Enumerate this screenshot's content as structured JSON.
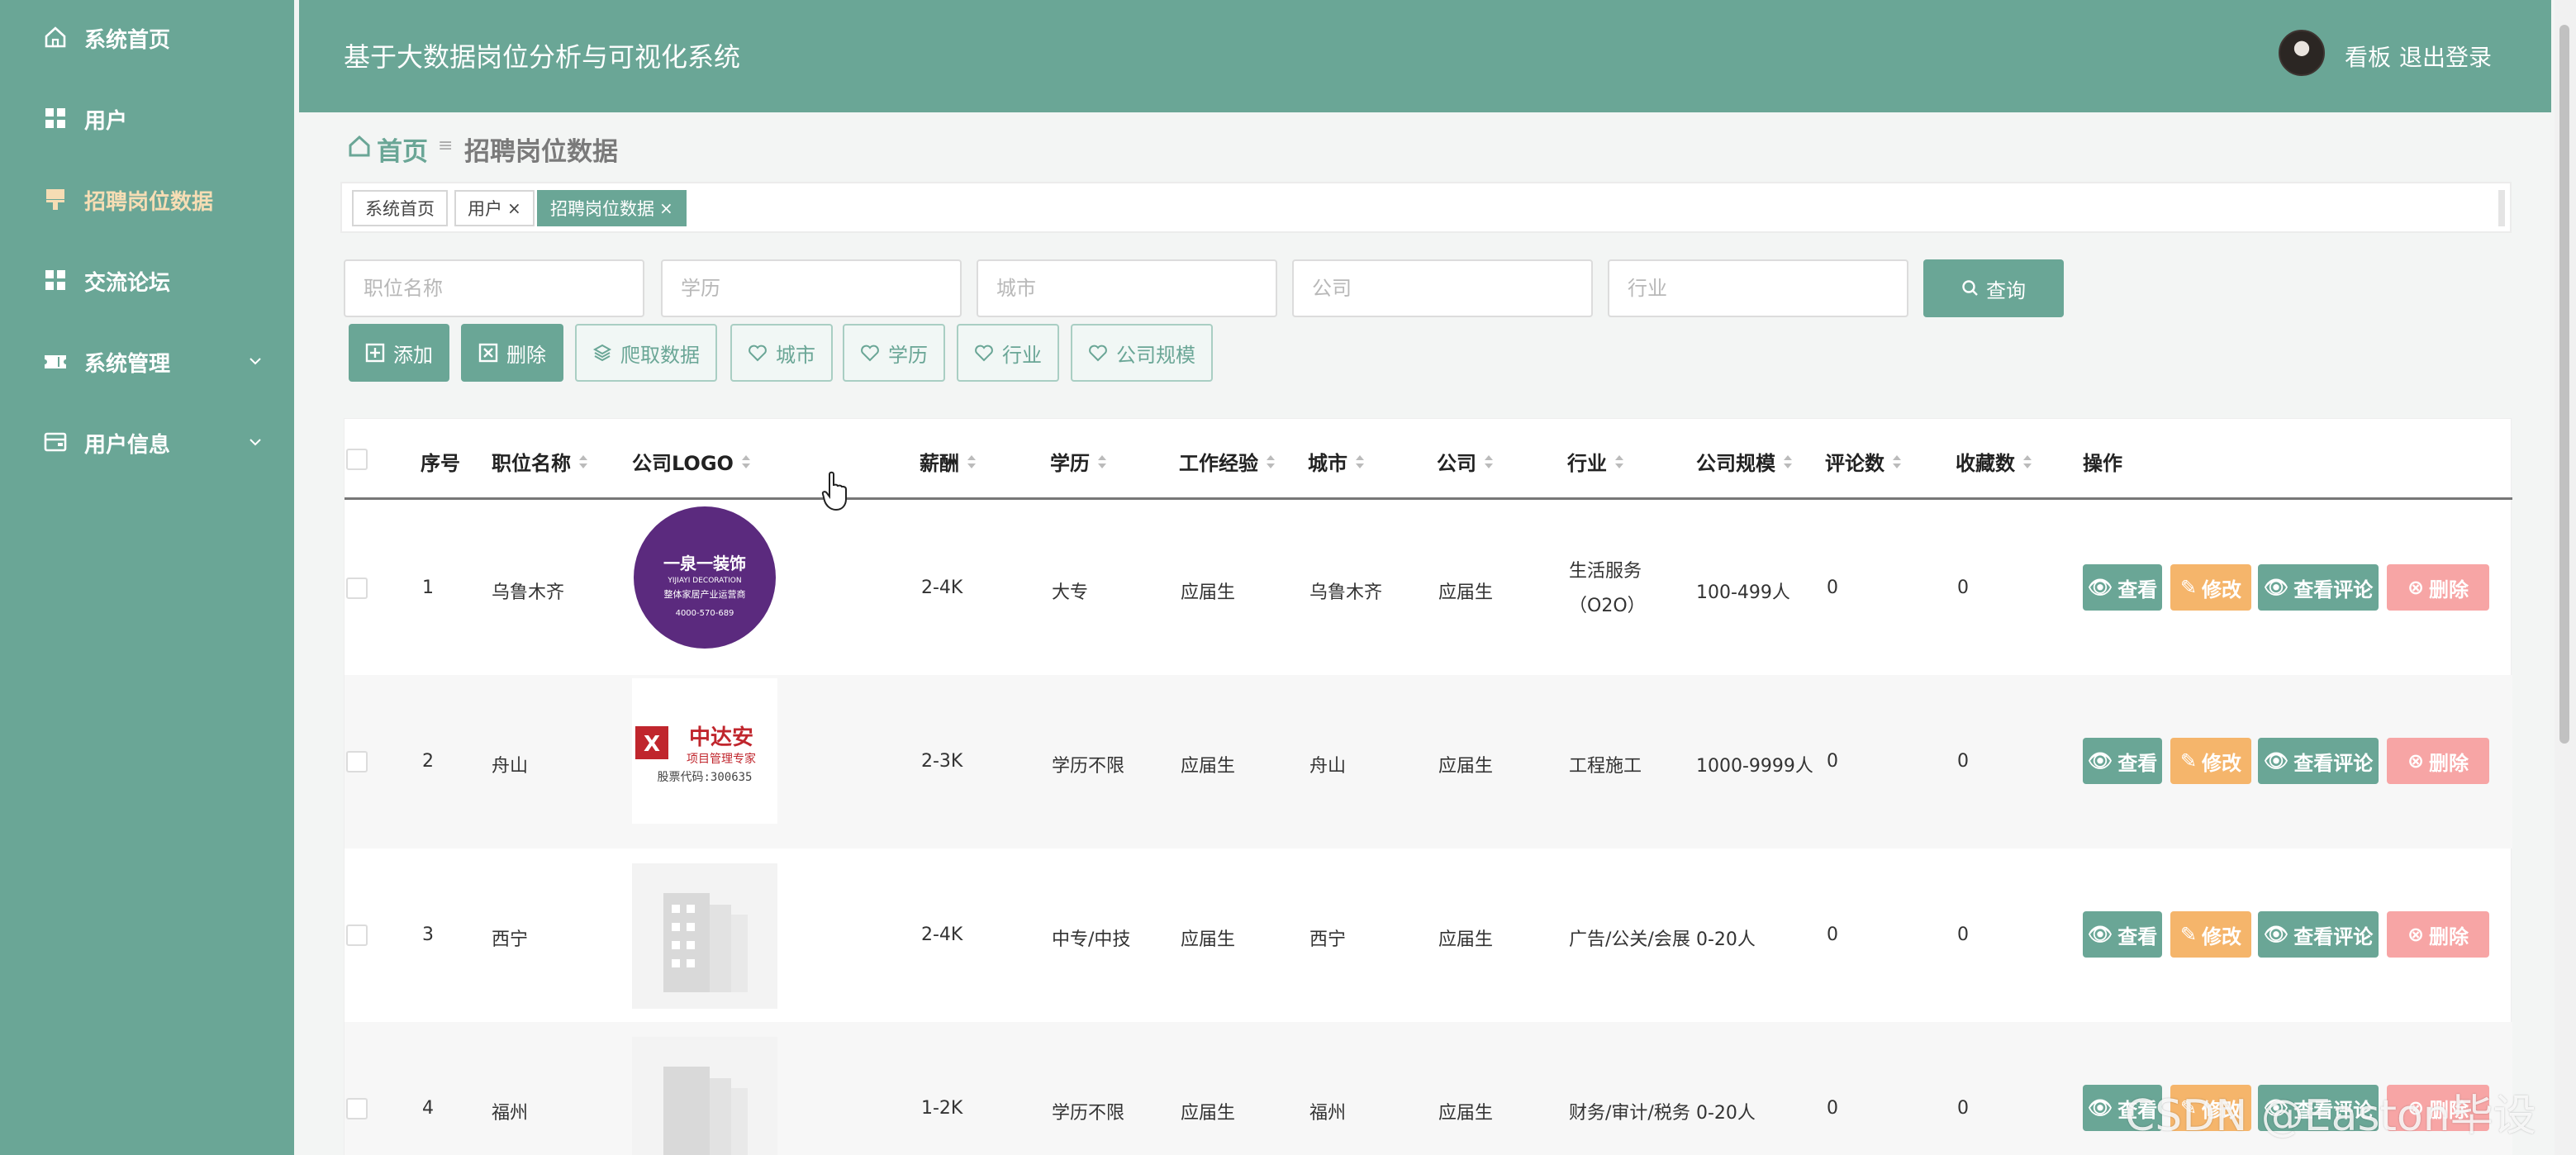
{
  "app": {
    "title": "基于大数据岗位分析与可视化系统",
    "board_link": "看板",
    "logout_link": "退出登录"
  },
  "sidebar": {
    "items": [
      {
        "label": "系统首页",
        "icon": "home-icon"
      },
      {
        "label": "用户",
        "icon": "grid-icon"
      },
      {
        "label": "招聘岗位数据",
        "icon": "brush-icon",
        "active": true
      },
      {
        "label": "交流论坛",
        "icon": "grid-icon"
      },
      {
        "label": "系统管理",
        "icon": "ticket-icon",
        "expandable": true
      },
      {
        "label": "用户信息",
        "icon": "wallet-icon",
        "expandable": true
      }
    ]
  },
  "breadcrumb": {
    "home": "首页",
    "current": "招聘岗位数据"
  },
  "tags": [
    {
      "label": "系统首页",
      "closable": false
    },
    {
      "label": "用户",
      "closable": true
    },
    {
      "label": "招聘岗位数据",
      "closable": true,
      "active": true
    }
  ],
  "search": {
    "job_placeholder": "职位名称",
    "edu_placeholder": "学历",
    "city_placeholder": "城市",
    "company_placeholder": "公司",
    "industry_placeholder": "行业",
    "query_label": "查询"
  },
  "actions": {
    "add": "添加",
    "delete": "删除",
    "crawl": "爬取数据",
    "city": "城市",
    "edu": "学历",
    "industry": "行业",
    "scale": "公司规模"
  },
  "table": {
    "headers": [
      "序号",
      "职位名称",
      "公司LOGO",
      "薪酬",
      "学历",
      "工作经验",
      "城市",
      "公司",
      "行业",
      "公司规模",
      "评论数",
      "收藏数",
      "操作"
    ],
    "row_buttons": {
      "view": "查看",
      "edit": "修改",
      "comments": "查看评论",
      "delete": "删除"
    },
    "rows": [
      {
        "no": "1",
        "job": "乌鲁木齐",
        "logo": {
          "type": "circle",
          "line1": "一泉一装饰",
          "line2": "YIJIAYI DECORATION",
          "line3": "整体家居产业运营商",
          "line4": "4000-570-689"
        },
        "salary": "2-4K",
        "edu": "大专",
        "exp": "应届生",
        "city": "乌鲁木齐",
        "company": "应届生",
        "industry": "生活服务（O2O）",
        "scale": "100-499人",
        "comments": "0",
        "favorites": "0"
      },
      {
        "no": "2",
        "job": "舟山",
        "logo": {
          "type": "text",
          "line1": "中达安",
          "line2": "项目管理专家",
          "line3": "股票代码:300635"
        },
        "salary": "2-3K",
        "edu": "学历不限",
        "exp": "应届生",
        "city": "舟山",
        "company": "应届生",
        "industry": "工程施工",
        "scale": "1000-9999人",
        "comments": "0",
        "favorites": "0"
      },
      {
        "no": "3",
        "job": "西宁",
        "logo": {
          "type": "placeholder"
        },
        "salary": "2-4K",
        "edu": "中专/中技",
        "exp": "应届生",
        "city": "西宁",
        "company": "应届生",
        "industry": "广告/公关/会展",
        "scale": "0-20人",
        "comments": "0",
        "favorites": "0"
      },
      {
        "no": "4",
        "job": "福州",
        "logo": {
          "type": "placeholder"
        },
        "salary": "1-2K",
        "edu": "学历不限",
        "exp": "应届生",
        "city": "福州",
        "company": "应届生",
        "industry": "财务/审计/税务",
        "scale": "0-20人",
        "comments": "0",
        "favorites": "0"
      }
    ]
  },
  "watermark": "CSDN @Easton毕设",
  "colors": {
    "primary": "#6aa696",
    "edit": "#f5b56b",
    "delete": "#f7a5a5",
    "active_menu": "#f6ddb4"
  }
}
